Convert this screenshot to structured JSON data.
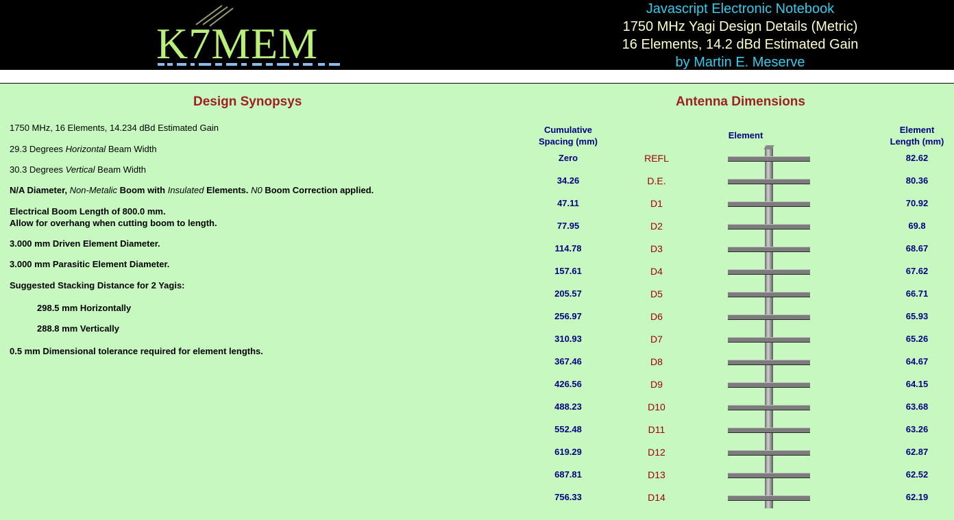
{
  "header": {
    "logo_text": "K7MEM",
    "logo_tag": "THE CALL SIGN OF K7MEM",
    "line1": "Javascript Electronic Notebook",
    "line2": "1750 MHz Yagi Design Details (Metric)",
    "line3": "16 Elements, 14.2 dBd Estimated Gain",
    "line4": "by Martin E. Meserve",
    "colors": {
      "cyan": "#33ccee",
      "cream": "#ffffcc"
    }
  },
  "synopsis": {
    "title": "Design Synopsys",
    "line1": "1750 MHz, 16 Elements, 14.234 dBd Estimated Gain",
    "hbw_prefix": "29.3 Degrees ",
    "hbw_em": "Horizontal",
    "hbw_suffix": " Beam Width",
    "vbw_prefix": "30.3 Degrees ",
    "vbw_em": "Vertical",
    "vbw_suffix": " Beam Width",
    "boom_a": "N/A Diameter, ",
    "boom_b": "Non-Metalic",
    "boom_c": " Boom with ",
    "boom_d": "Insulated",
    "boom_e": " Elements. ",
    "boom_f": "N0",
    "boom_g": " Boom Correction applied.",
    "boom_len": "Electrical Boom Length of 800.0 mm.",
    "overhang": "Allow for overhang when cutting boom to length.",
    "de_diam": "3.000 mm Driven Element Diameter.",
    "pe_diam": "3.000 mm Parasitic Element Diameter.",
    "stack": "Suggested Stacking Distance for 2 Yagis:",
    "stack_h": "298.5 mm Horizontally",
    "stack_v": "288.8 mm Vertically",
    "tolerance": "0.5 mm Dimensional tolerance required for element lengths."
  },
  "dimensions": {
    "title": "Antenna Dimensions",
    "col_spacing_1": "Cumulative",
    "col_spacing_2": "Spacing (mm)",
    "col_element": "Element",
    "col_length_1": "Element",
    "col_length_2": "Length (mm)",
    "rows": [
      {
        "spacing": "Zero",
        "name": "REFL",
        "length": "82.62"
      },
      {
        "spacing": "34.26",
        "name": "D.E.",
        "length": "80.36"
      },
      {
        "spacing": "47.11",
        "name": "D1",
        "length": "70.92"
      },
      {
        "spacing": "77.95",
        "name": "D2",
        "length": "69.8"
      },
      {
        "spacing": "114.78",
        "name": "D3",
        "length": "68.67"
      },
      {
        "spacing": "157.61",
        "name": "D4",
        "length": "67.62"
      },
      {
        "spacing": "205.57",
        "name": "D5",
        "length": "66.71"
      },
      {
        "spacing": "256.97",
        "name": "D6",
        "length": "65.93"
      },
      {
        "spacing": "310.93",
        "name": "D7",
        "length": "65.26"
      },
      {
        "spacing": "367.46",
        "name": "D8",
        "length": "64.67"
      },
      {
        "spacing": "426.56",
        "name": "D9",
        "length": "64.15"
      },
      {
        "spacing": "488.23",
        "name": "D10",
        "length": "63.68"
      },
      {
        "spacing": "552.48",
        "name": "D11",
        "length": "63.26"
      },
      {
        "spacing": "619.29",
        "name": "D12",
        "length": "62.87"
      },
      {
        "spacing": "687.81",
        "name": "D13",
        "length": "62.52"
      },
      {
        "spacing": "756.33",
        "name": "D14",
        "length": "62.19"
      }
    ]
  }
}
